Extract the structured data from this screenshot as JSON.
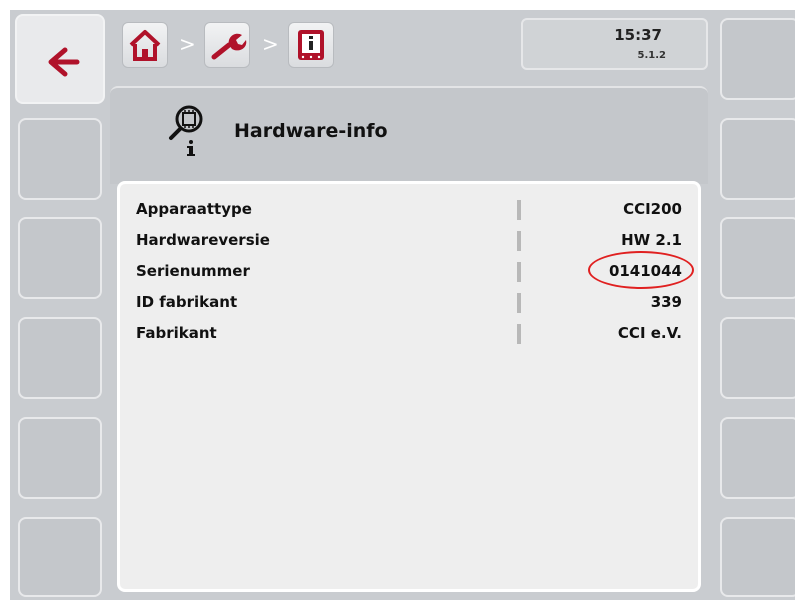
{
  "toolbar": {
    "back_icon": "arrow-left-icon",
    "breadcrumb": [
      {
        "icon": "home-icon"
      },
      {
        "icon": "wrench-icon"
      },
      {
        "icon": "info-panel-icon"
      }
    ],
    "separator": ">"
  },
  "status": {
    "time": "15:37",
    "version": "5.1.2"
  },
  "header": {
    "title": "Hardware-info",
    "icon": "chip-magnifier-info-icon"
  },
  "info": {
    "rows": [
      {
        "label": "Apparaattype",
        "value": "CCI200"
      },
      {
        "label": "Hardwareversie",
        "value": "HW 2.1"
      },
      {
        "label": "Serienummer",
        "value": "0141044",
        "highlighted": true
      },
      {
        "label": "ID fabrikant",
        "value": "339"
      },
      {
        "label": "Fabrikant",
        "value": "CCI e.V."
      }
    ]
  },
  "colors": {
    "accent": "#b0122a",
    "highlight": "#e02020",
    "background": "#c9ccd0"
  }
}
